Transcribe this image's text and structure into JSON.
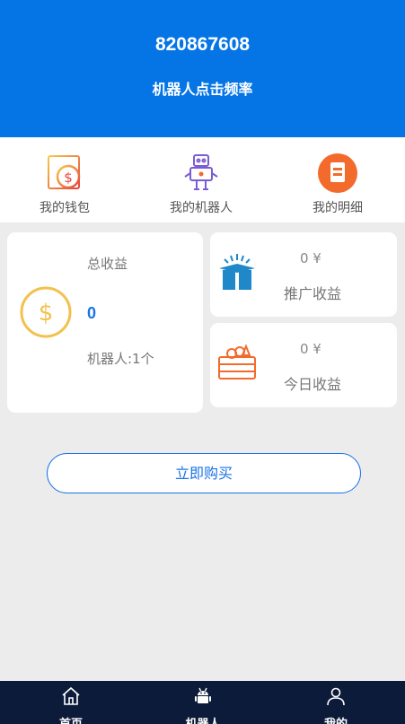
{
  "header": {
    "user_id": "820867608",
    "subtitle": "机器人点击频率"
  },
  "quick": [
    {
      "label": "我的钱包",
      "icon": "wallet-icon"
    },
    {
      "label": "我的机器人",
      "icon": "robot-icon"
    },
    {
      "label": "我的明细",
      "icon": "details-icon"
    }
  ],
  "total": {
    "label": "总收益",
    "value": "0",
    "robot_count": "机器人:1个",
    "icon": "coin-icon"
  },
  "promo": {
    "value": "0 ¥",
    "label": "推广收益",
    "icon": "gift-box-icon"
  },
  "today": {
    "value": "0 ¥",
    "label": "今日收益",
    "icon": "crate-icon"
  },
  "buy_button": "立即购买",
  "tabs": [
    {
      "label": "首页",
      "icon": "home-icon"
    },
    {
      "label": "机器人",
      "icon": "android-icon"
    },
    {
      "label": "我的",
      "icon": "user-icon"
    }
  ],
  "colors": {
    "primary": "#0575e6",
    "tabbar": "#0d1b3a",
    "accent_orange": "#f36b2c",
    "coin_yellow": "#f2c14e"
  }
}
